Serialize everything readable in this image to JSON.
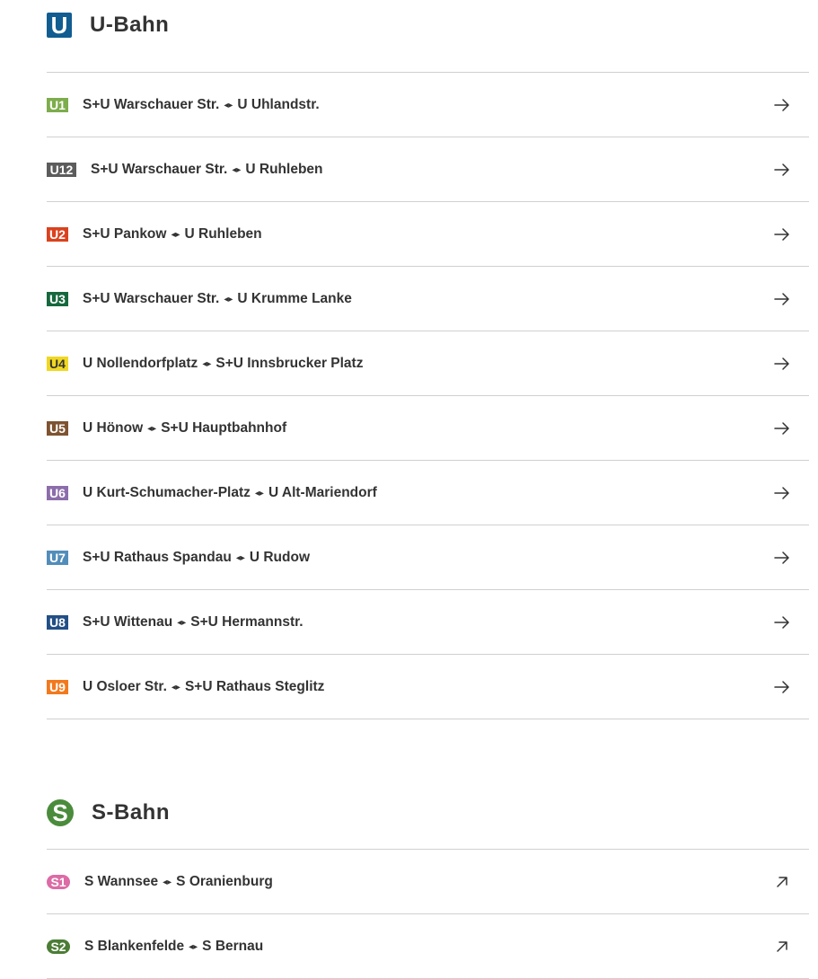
{
  "ubahn": {
    "logo": "U",
    "title": "U-Bahn",
    "lines": [
      {
        "label": "U1",
        "color": "#7dad4c",
        "from": "S+U Warschauer Str.",
        "sep": "◂▸",
        "to": "U Uhlandstr."
      },
      {
        "label": "U12",
        "color": "#5c5c5c",
        "from": "S+U Warschauer Str.",
        "sep": "◂▸",
        "to": "U Ruhleben"
      },
      {
        "label": "U2",
        "color": "#da421e",
        "from": "S+U Pankow",
        "sep": "◂▸",
        "to": "U Ruhleben"
      },
      {
        "label": "U3",
        "color": "#16683d",
        "from": "S+U Warschauer Str.",
        "sep": "◂▸",
        "to": "U Krumme Lanke"
      },
      {
        "label": "U4",
        "color": "#f0d722",
        "from": "U Nollendorfplatz",
        "sep": "◂▸",
        "to": "S+U Innsbrucker Platz"
      },
      {
        "label": "U5",
        "color": "#7e5330",
        "from": "U Hönow",
        "sep": "◂▸",
        "to": "S+U Hauptbahnhof"
      },
      {
        "label": "U6",
        "color": "#8c6dab",
        "from": "U Kurt-Schumacher-Platz",
        "sep": "◂▸",
        "to": "U Alt-Mariendorf"
      },
      {
        "label": "U7",
        "color": "#528dba",
        "from": "S+U Rathaus Spandau",
        "sep": "◂▸",
        "to": "U Rudow"
      },
      {
        "label": "U8",
        "color": "#224f86",
        "from": "S+U Wittenau",
        "sep": "◂▸",
        "to": "S+U Hermannstr."
      },
      {
        "label": "U9",
        "color": "#f3791d",
        "from": "U Osloer Str.",
        "sep": "◂▸",
        "to": "S+U Rathaus Steglitz"
      }
    ]
  },
  "sbahn": {
    "logo": "S",
    "title": "S-Bahn",
    "lines": [
      {
        "label": "S1",
        "color": "#dc6ba6",
        "from": "S Wannsee",
        "sep": "◂▸",
        "to": "S Oranienburg"
      },
      {
        "label": "S2",
        "color": "#4b7d35",
        "from": "S Blankenfelde",
        "sep": "◂▸",
        "to": "S Bernau"
      }
    ]
  },
  "icons": {
    "row_arrow_u": "arrow-right-icon",
    "row_arrow_s": "arrow-up-right-icon"
  }
}
